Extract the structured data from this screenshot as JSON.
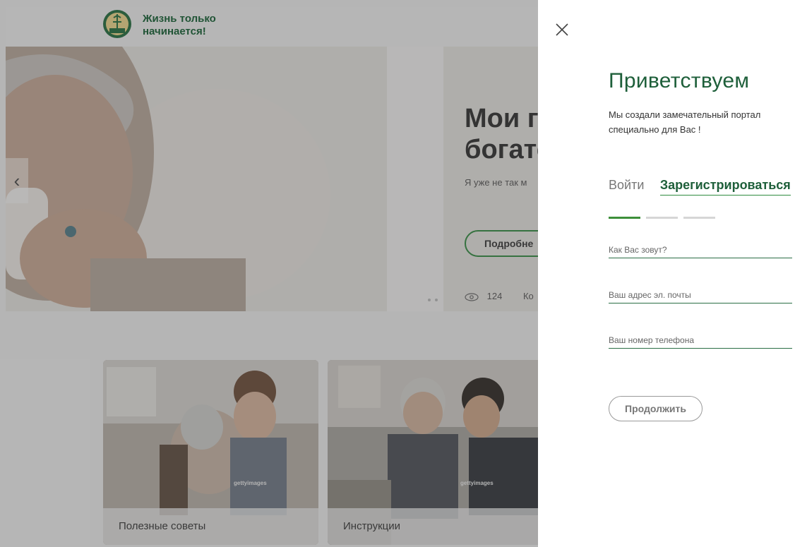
{
  "header": {
    "tagline": "Жизнь только\nначинается!",
    "logo_icon": "bank-emblem-icon"
  },
  "hero": {
    "title": "Мои го\nбогатс",
    "subtitle": "Я уже не так м",
    "more_label": "Подробне",
    "views": "124",
    "comments_label": "Ко",
    "prev_icon": "chevron-left-icon",
    "eye_icon": "eye-icon"
  },
  "cards": [
    {
      "label": "Полезные советы"
    },
    {
      "label": "Инструкции"
    }
  ],
  "panel": {
    "close_icon": "close-icon",
    "welcome": "Приветствуем",
    "intro": "Мы создали замечательный портал специально для Вас !",
    "tabs": {
      "login": "Войти",
      "register": "Зарегистрироваться"
    },
    "steps_total": 3,
    "steps_active": 1,
    "fields": {
      "name_placeholder": "Как Вас зовут?",
      "email_placeholder": "Ваш адрес эл. почты",
      "phone_placeholder": "Ваш номер телефона"
    },
    "continue_label": "Продолжить"
  },
  "colors": {
    "brand_green": "#1e5f3a",
    "accent_green": "#3d8f3a",
    "overlay": "#464646"
  }
}
